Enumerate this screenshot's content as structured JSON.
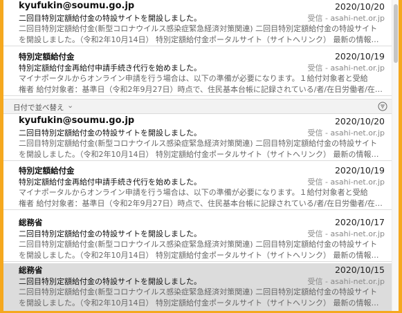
{
  "top_messages": [
    {
      "sender": "kyufukin@soumu.go.jp",
      "date": "2020/10/20",
      "subject": "二回目特別定額給付金の特設サイトを開設しました。",
      "mailbox": "受信 - asahi-net.or.jp",
      "preview": [
        "二回目特別定額給付金(新型コロナウイルス感染症緊急経済対策関連) 二回目特別定額給付金の特設サイト",
        "を開設しました。（令和2年10月14日） 特別定額給付金ポータルサイト（サイトへリンク） 最新の情報につ…"
      ]
    },
    {
      "sender": "特別定額給付金",
      "date": "2020/10/19",
      "subject": "特別定額給付金再給付申請手続き代行を始めました。",
      "mailbox": "受信 - asahi-net.or.jp",
      "preview": [
        "マイナポータルからオンライン申請を行う場合は、以下の準備が必要になります。１給付対象者と受給",
        "権者 給付対象者：基準日（令和2年9月27日）時点で、住民基本台帳に記録されている/者/在日労働者/在…"
      ]
    }
  ],
  "sort_bar": {
    "label": "日付で並べ替え",
    "chevron": "⌄",
    "filter_icon": "filter-icon"
  },
  "messages": [
    {
      "sender": "kyufukin@soumu.go.jp",
      "date": "2020/10/20",
      "subject": "二回目特別定額給付金の特設サイトを開設しました。",
      "mailbox": "受信 - asahi-net.or.jp",
      "preview": [
        "二回目特別定額給付金(新型コロナウイルス感染症緊急経済対策関連) 二回目特別定額給付金の特設サイト",
        "を開設しました。（令和2年10月14日） 特別定額給付金ポータルサイト（サイトへリンク） 最新の情報につ…"
      ]
    },
    {
      "sender": "特別定額給付金",
      "date": "2020/10/19",
      "subject": "特別定額給付金再給付申請手続き代行を始めました。",
      "mailbox": "受信 - asahi-net.or.jp",
      "preview": [
        "マイナポータルからオンライン申請を行う場合は、以下の準備が必要になります。１給付対象者と受給",
        "権者 給付対象者：基準日（令和2年9月27日）時点で、住民基本台帳に記録されている/者/在日労働者/在…"
      ]
    },
    {
      "sender": "総務省",
      "date": "2020/10/17",
      "subject": "二回目特別定額給付金の特設サイトを開設しました。",
      "mailbox": "受信 - asahi-net.or.jp",
      "preview": [
        "二回目特別定額給付金(新型コロナウイルス感染症緊急経済対策関連) 二回目特別定額給付金の特設サイト",
        "を開設しました。（令和2年10月14日） 特別定額給付金ポータルサイト（サイトへリンク） 最新の情報につ…"
      ]
    },
    {
      "sender": "総務省",
      "date": "2020/10/15",
      "subject": "二回目特別定額給付金の特設サイトを開設しました。",
      "mailbox": "受信 - asahi-net.or.jp",
      "preview": [
        "二回目特別定額給付金(新型コロナウイルス感染症緊急経済対策関連) 二回目特別定額給付金の特設サイト",
        "を開設しました。（令和2年10月14日） 特別定額給付金ポータルサイト（サイトへリンク） 最新の情報につ…"
      ],
      "selected": true
    }
  ]
}
